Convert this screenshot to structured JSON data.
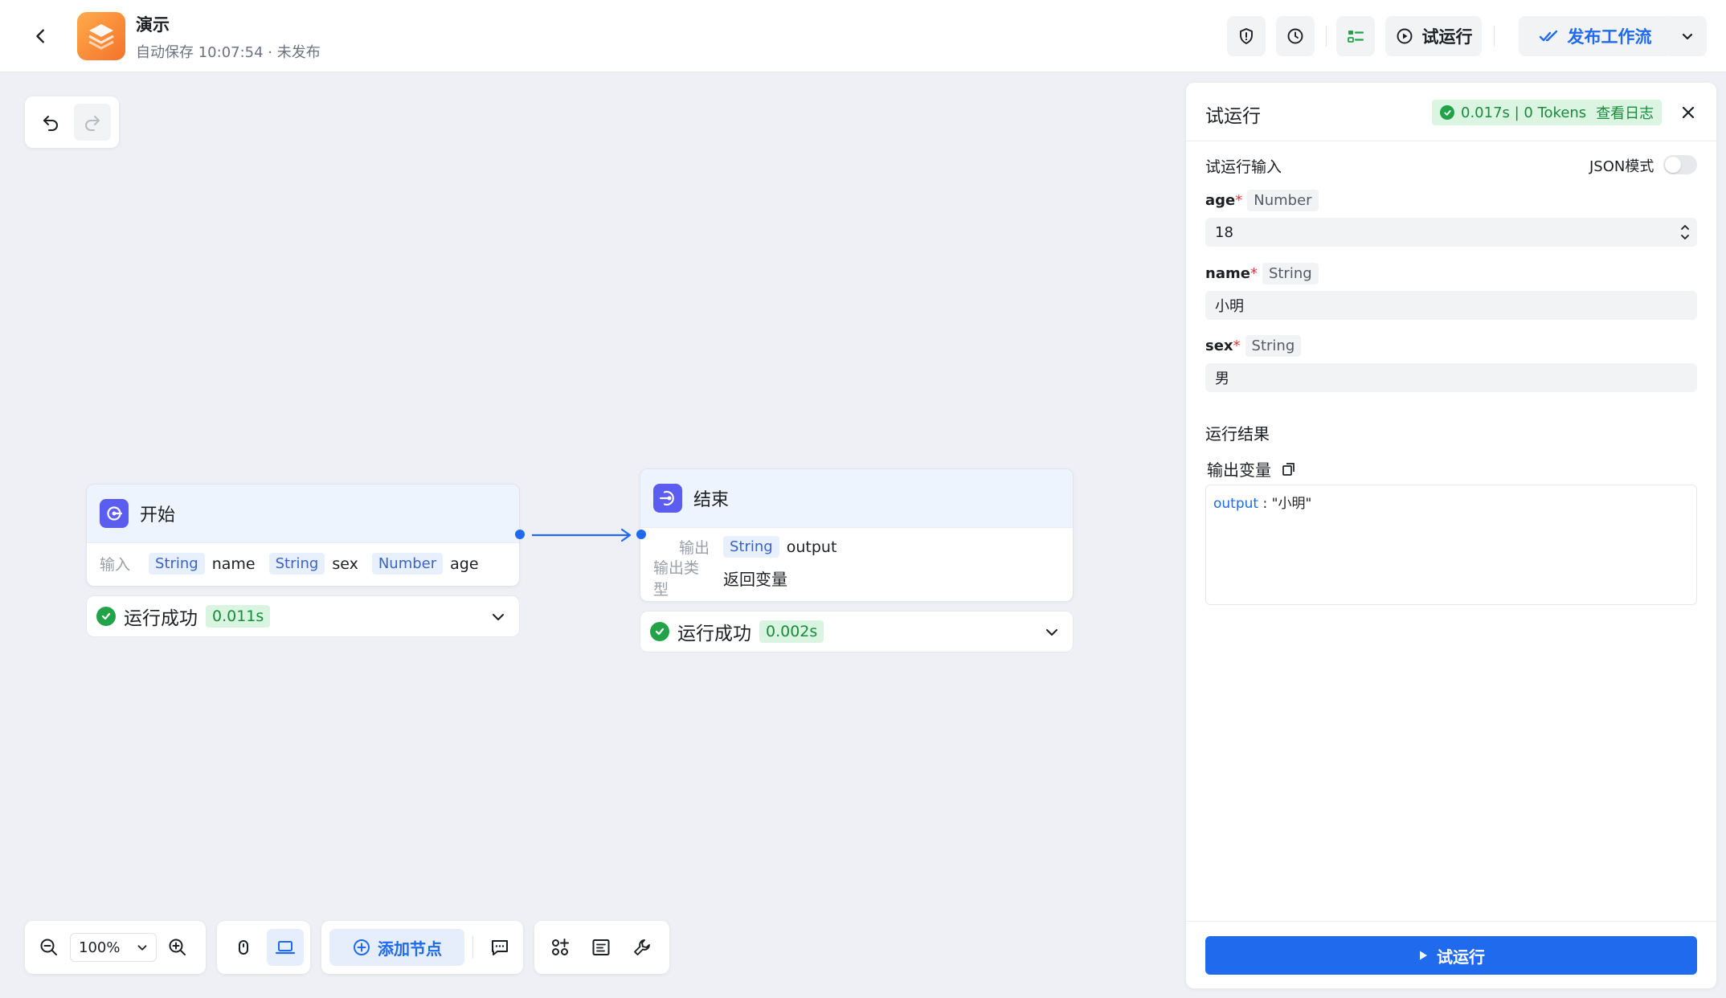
{
  "header": {
    "app_title": "演示",
    "autosave_text": "自动保存 10:07:54 · 未发布",
    "test_run_label": "试运行",
    "publish_label": "发布工作流"
  },
  "canvas": {
    "start_node": {
      "title": "开始",
      "input_label": "输入",
      "params": [
        {
          "type": "String",
          "name": "name"
        },
        {
          "type": "String",
          "name": "sex"
        },
        {
          "type": "Number",
          "name": "age"
        }
      ],
      "status": "运行成功",
      "time": "0.011s"
    },
    "end_node": {
      "title": "结束",
      "output_label": "输出",
      "output_type": "String",
      "output_name": "output",
      "output_kind_label": "输出类型",
      "output_kind_value": "返回变量",
      "status": "运行成功",
      "time": "0.002s"
    }
  },
  "bottom_toolbar": {
    "zoom": "100%",
    "add_node_label": "添加节点"
  },
  "panel": {
    "title": "试运行",
    "run_stats": "0.017s | 0 Tokens",
    "view_log": "查看日志",
    "input_section": "试运行输入",
    "json_mode_label": "JSON模式",
    "json_mode_on": false,
    "fields": [
      {
        "name": "age",
        "required": "*",
        "type": "Number",
        "value": "18"
      },
      {
        "name": "name",
        "required": "*",
        "type": "String",
        "value": "小明"
      },
      {
        "name": "sex",
        "required": "*",
        "type": "String",
        "value": "男"
      }
    ],
    "result_section": "运行结果",
    "output_vars_label": "输出变量",
    "output_key": "output",
    "output_sep": " : ",
    "output_value": "\"小明\"",
    "run_button": "试运行"
  },
  "colors": {
    "accent": "#1f6aed",
    "success": "#22a348",
    "node_icon": "#5b5cf0",
    "app_logo": "#f4732a"
  }
}
